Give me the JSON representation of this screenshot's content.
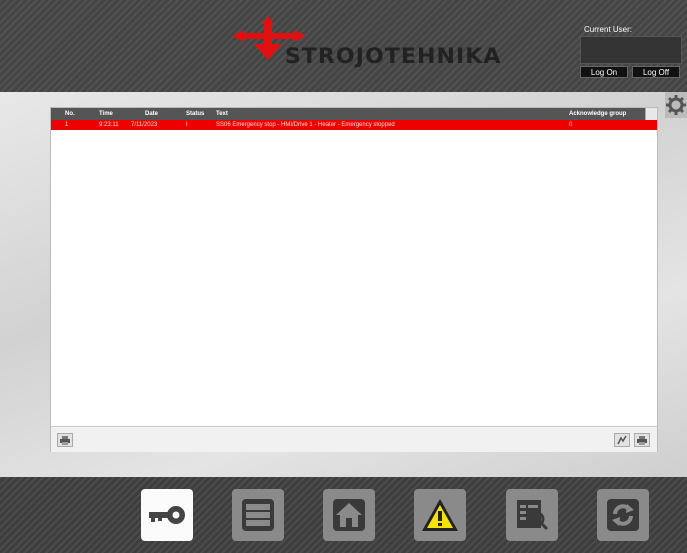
{
  "header": {
    "brand": "STROJOTEHNIKA",
    "current_user_label": "Current User:",
    "current_user_value": "",
    "log_on_label": "Log On",
    "log_off_label": "Log Off"
  },
  "alarm_table": {
    "columns": [
      "No.",
      "Time",
      "Date",
      "Status",
      "Text",
      "Acknowledge group"
    ],
    "rows": [
      {
        "no": "1",
        "time": "9:23:11",
        "date": "7/11/2023",
        "status": "I",
        "text": "SS06 Emergency stop - HMI/Drive 1 - Heater - Emergency stopped",
        "group": "0"
      }
    ]
  },
  "bottom_nav": {
    "items": [
      {
        "icon": "key-icon",
        "active": true
      },
      {
        "icon": "list-icon",
        "active": false
      },
      {
        "icon": "home-icon",
        "active": false
      },
      {
        "icon": "warning-icon",
        "active": false
      },
      {
        "icon": "report-search-icon",
        "active": false
      },
      {
        "icon": "refresh-icon",
        "active": false
      }
    ]
  },
  "colors": {
    "alarm_row": "#ee0000",
    "warning_yellow": "#f2e400",
    "logo_red": "#e01010"
  }
}
